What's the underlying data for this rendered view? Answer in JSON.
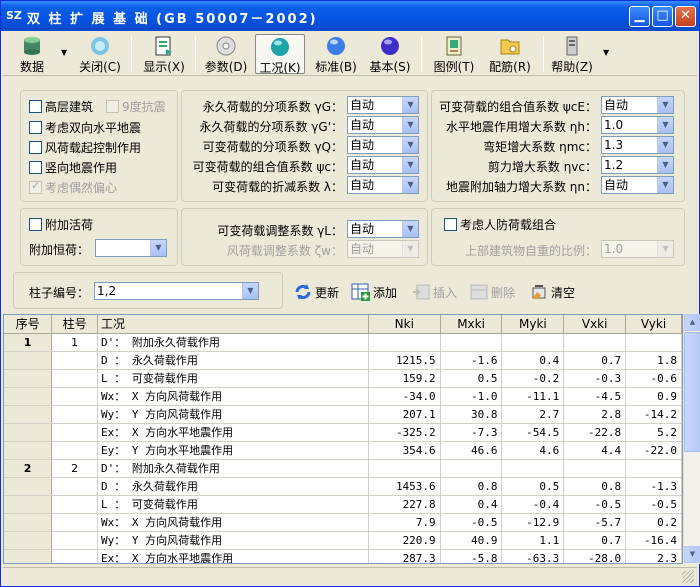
{
  "window": {
    "logo": "SZ",
    "title": "双 柱 扩 展 基 础 (GB 50007－2002)"
  },
  "toolbar": [
    {
      "label": "数据",
      "icon": "database-icon"
    },
    {
      "label": "关闭(C)",
      "icon": "close-disc-icon"
    },
    {
      "label": "显示(X)",
      "icon": "display-icon"
    },
    {
      "label": "参数(D)",
      "icon": "disc-icon"
    },
    {
      "label": "工况(K)",
      "icon": "teal-sphere-icon"
    },
    {
      "label": "标准(B)",
      "icon": "blue-sphere-icon"
    },
    {
      "label": "基本(S)",
      "icon": "purple-sphere-icon"
    },
    {
      "label": "图例(T)",
      "icon": "legend-icon"
    },
    {
      "label": "配筋(R)",
      "icon": "folder-icon"
    },
    {
      "label": "帮助(Z)",
      "icon": "help-icon"
    }
  ],
  "panel1": {
    "checks": [
      {
        "label": "高层建筑",
        "checked": false,
        "enabled": true
      },
      {
        "label": "9度抗震",
        "checked": false,
        "enabled": false
      },
      {
        "label": "考虑双向水平地震",
        "checked": false,
        "enabled": true
      },
      {
        "label": "风荷载起控制作用",
        "checked": false,
        "enabled": true
      },
      {
        "label": "竖向地震作用",
        "checked": false,
        "enabled": true
      },
      {
        "label": "考虑偶然偏心",
        "checked": true,
        "enabled": false
      }
    ],
    "coef_mid": [
      {
        "label": "永久荷载的分项系数 γG：",
        "value": "自动"
      },
      {
        "label": "永久荷载的分项系数 γG'：",
        "value": "自动"
      },
      {
        "label": "可变荷载的分项系数 γQ：",
        "value": "自动"
      },
      {
        "label": "可变荷载的组合值系数 ψc：",
        "value": "自动"
      },
      {
        "label": "可变荷载的折减系数 λ：",
        "value": "自动"
      }
    ],
    "coef_right": [
      {
        "label": "可变荷载的组合值系数 ψcE：",
        "value": "自动"
      },
      {
        "label": "水平地震作用增大系数 ηh：",
        "value": "1.0"
      },
      {
        "label": "弯矩增大系数 ηmc：",
        "value": "1.3"
      },
      {
        "label": "剪力增大系数 ηvc：",
        "value": "1.2"
      },
      {
        "label": "地震附加轴力增大系数 ηn：",
        "value": "自动"
      }
    ]
  },
  "panel2": {
    "extra_live": "附加活荷",
    "extra_dead_label": "附加恒荷：",
    "extra_dead_value": "",
    "live_adjust_label": "可变荷载调整系数 γL：",
    "live_adjust_value": "自动",
    "wind_adjust_label": "风荷载调整系数 ζw：",
    "wind_adjust_value": "自动",
    "civil_defense": "考虑人防荷载组合",
    "upper_ratio_label": "上部建筑物自重的比例：",
    "upper_ratio_value": "1.0"
  },
  "column_bar": {
    "label": "柱子编号：",
    "value": "1,2",
    "refresh": "更新",
    "add": "添加",
    "insert": "插入",
    "delete": "删除",
    "clear": "清空"
  },
  "grid": {
    "headers": [
      "序号",
      "柱号",
      "工况",
      "Nki",
      "Mxki",
      "Myki",
      "Vxki",
      "Vyki"
    ],
    "rows": [
      {
        "seq": "1",
        "col": "1",
        "case": "D'： 附加永久荷载作用",
        "v": [
          "",
          "",
          "",
          "",
          ""
        ]
      },
      {
        "seq": "",
        "col": "",
        "case": "D ： 永久荷载作用",
        "v": [
          "1215.5",
          "-1.6",
          "0.4",
          "0.7",
          "1.8"
        ]
      },
      {
        "seq": "",
        "col": "",
        "case": "L ： 可变荷载作用",
        "v": [
          "159.2",
          "0.5",
          "-0.2",
          "-0.3",
          "-0.6"
        ]
      },
      {
        "seq": "",
        "col": "",
        "case": "Wx： X 方向风荷载作用",
        "v": [
          "-34.0",
          "-1.0",
          "-11.1",
          "-4.5",
          "0.9"
        ]
      },
      {
        "seq": "",
        "col": "",
        "case": "Wy： Y 方向风荷载作用",
        "v": [
          "207.1",
          "30.8",
          "2.7",
          "2.8",
          "-14.2"
        ]
      },
      {
        "seq": "",
        "col": "",
        "case": "Ex： X 方向水平地震作用",
        "v": [
          "-325.2",
          "-7.3",
          "-54.5",
          "-22.8",
          "5.2"
        ]
      },
      {
        "seq": "",
        "col": "",
        "case": "Ey： Y 方向水平地震作用",
        "v": [
          "354.6",
          "46.6",
          "4.6",
          "4.4",
          "-22.0"
        ]
      },
      {
        "seq": "2",
        "col": "2",
        "case": "D'： 附加永久荷载作用",
        "v": [
          "",
          "",
          "",
          "",
          ""
        ]
      },
      {
        "seq": "",
        "col": "",
        "case": "D ： 永久荷载作用",
        "v": [
          "1453.6",
          "0.8",
          "0.5",
          "0.8",
          "-1.3"
        ]
      },
      {
        "seq": "",
        "col": "",
        "case": "L ： 可变荷载作用",
        "v": [
          "227.8",
          "0.4",
          "-0.4",
          "-0.5",
          "-0.5"
        ]
      },
      {
        "seq": "",
        "col": "",
        "case": "Wx： X 方向风荷载作用",
        "v": [
          "7.9",
          "-0.5",
          "-12.9",
          "-5.7",
          "0.2"
        ]
      },
      {
        "seq": "",
        "col": "",
        "case": "Wy： Y 方向风荷载作用",
        "v": [
          "220.9",
          "40.9",
          "1.1",
          "0.7",
          "-16.4"
        ]
      },
      {
        "seq": "",
        "col": "",
        "case": "Ex： X 方向水平地震作用",
        "v": [
          "287.3",
          "-5.8",
          "-63.3",
          "-28.0",
          "2.3"
        ]
      }
    ]
  }
}
